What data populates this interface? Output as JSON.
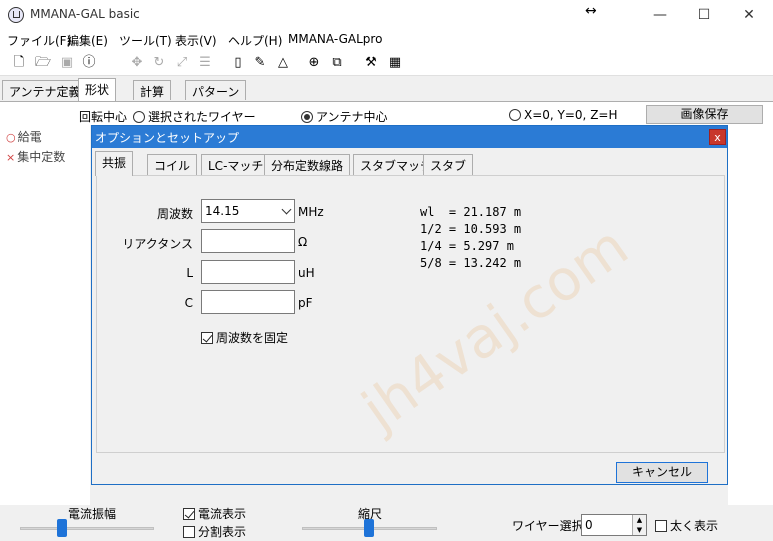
{
  "window": {
    "title": "MMANA-GAL basic",
    "resize_glyph": "↔",
    "minimize": "—",
    "maximize": "☐",
    "close": "✕"
  },
  "menu": [
    "ファイル(F)",
    "編集(E)",
    "ツール(T)",
    "表示(V)",
    "ヘルプ(H)",
    "MMANA-GALpro"
  ],
  "toolbar": {
    "icons": [
      "new-file-icon",
      "open-folder-icon",
      "save-icon",
      "info-icon",
      "move-icon",
      "rotate-icon",
      "resize-icon",
      "align-icon",
      "document-icon",
      "pen-icon",
      "triangle-icon",
      "crosshair-icon",
      "copy-icon",
      "tools-icon",
      "calculator-icon"
    ]
  },
  "main_tabs": [
    "アンテナ定義",
    "形状",
    "計算",
    "パターン"
  ],
  "options_bar": {
    "rotation_label": "回転中心",
    "selected_wires": "選択されたワイヤー",
    "antenna_center": "アンテナ中心",
    "origin": "X=0, Y=0, Z=H",
    "save_image": "画像保存"
  },
  "left_panel": {
    "items": [
      "給電",
      "集中定数"
    ]
  },
  "dialog": {
    "title": "オプションとセットアップ",
    "close": "x",
    "tabs": [
      "共振",
      "コイル",
      "LC-マッチ",
      "分布定数線路",
      "スタブマッチ",
      "スタブ"
    ],
    "fields": {
      "frequency": {
        "label": "周波数",
        "value": "14.15",
        "unit": "MHz"
      },
      "reactance": {
        "label": "リアクタンス",
        "value": "",
        "unit": "Ω"
      },
      "inductance": {
        "label": "L",
        "value": "",
        "unit": "uH"
      },
      "capacitance": {
        "label": "C",
        "value": "",
        "unit": "pF"
      }
    },
    "fix_frequency": "周波数を固定",
    "results": [
      "wl  = 21.187 m",
      "1/2 = 10.593 m",
      "1/4 = 5.297 m",
      "5/8 = 13.242 m"
    ],
    "cancel": "キャンセル",
    "watermark": "jh4vaj.com"
  },
  "status_bar": {
    "current_amplitude": "電流振幅",
    "current_display": "電流表示",
    "split_display": "分割表示",
    "scale": "縮尺",
    "wire_select": "ワイヤー選択",
    "wire_value": "0",
    "bold_display": "太く表示"
  }
}
